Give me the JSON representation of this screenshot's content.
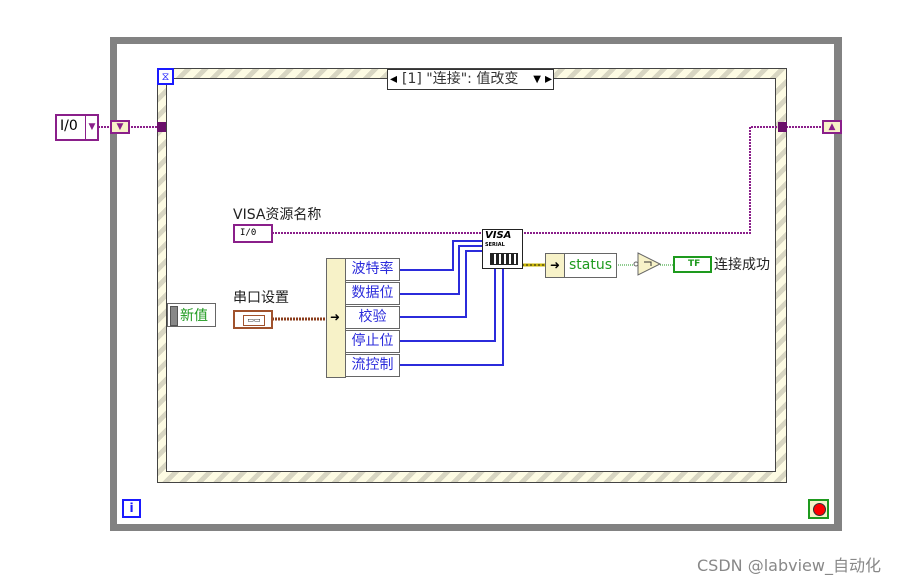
{
  "event_selector": {
    "label": "[1] \"连接\": 值改变"
  },
  "controls": {
    "visa_resource_label": "VISA资源名称",
    "visa_resource_glyph": "I/0",
    "serial_settings_label": "串口设置",
    "new_value_label": "新值"
  },
  "unbundle": {
    "items": [
      "波特率",
      "数据位",
      "校验",
      "停止位",
      "流控制"
    ]
  },
  "visa_node": {
    "title": "VISA",
    "subtitle": "SERIAL"
  },
  "status_unbundle": {
    "label": "status"
  },
  "indicator": {
    "glyph": "TF",
    "label": "连接成功"
  },
  "iteration": {
    "glyph": "i"
  },
  "watermark": "CSDN @labview_自动化",
  "colors": {
    "loop_border": "#828282",
    "visa_wire": "#8a1f8a",
    "numeric_wire": "#2b2bdb",
    "bool_wire": "#1e9a1e",
    "cluster_wire": "#8a3b1a",
    "error_wire": "#c8b400"
  }
}
